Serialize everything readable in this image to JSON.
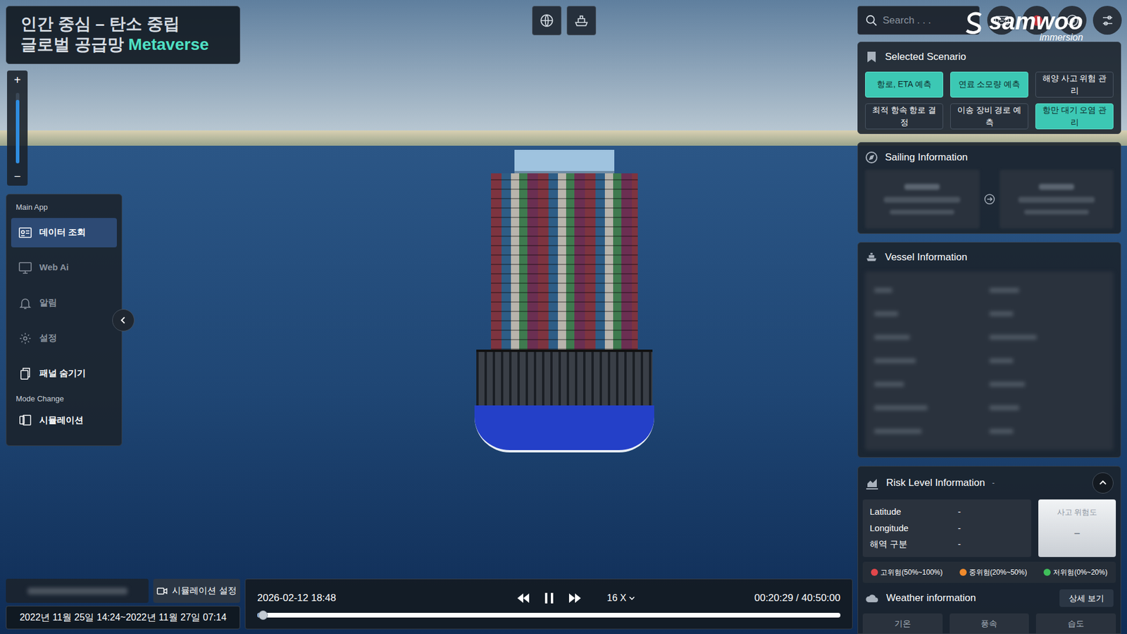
{
  "title": {
    "line1": "인간 중심 – 탄소 중립",
    "line2": "글로벌 공급망",
    "highlight": "Metaverse"
  },
  "zoom": {
    "plus": "+",
    "minus": "−",
    "level": 0.9
  },
  "menu": {
    "sections": [
      {
        "heading": "Main App",
        "items": [
          {
            "label": "데이터 조회",
            "selected": true,
            "disabled": false
          },
          {
            "label": "Web Ai",
            "selected": false,
            "disabled": true
          },
          {
            "label": "알림",
            "selected": false,
            "disabled": true
          },
          {
            "label": "설정",
            "selected": false,
            "disabled": true
          },
          {
            "label": "패널 숨기기",
            "selected": false,
            "disabled": false
          }
        ]
      },
      {
        "heading": "Mode Change",
        "items": [
          {
            "label": "시뮬레이션",
            "selected": false,
            "disabled": false
          }
        ]
      }
    ]
  },
  "search": {
    "placeholder": "Search . . ."
  },
  "logo": {
    "name": "samwoo",
    "tagline": "immersion"
  },
  "scenario": {
    "title": "Selected Scenario",
    "options": [
      {
        "label": "항로, ETA 예측",
        "selected": true
      },
      {
        "label": "연료 소모량 예측",
        "selected": true
      },
      {
        "label": "해양 사고 위험 관리",
        "selected": false
      },
      {
        "label": "최적 항속 항로 결정",
        "selected": false
      },
      {
        "label": "이송 장비 경로 예측",
        "selected": false
      },
      {
        "label": "항만 대기 오염 관리",
        "selected": true
      }
    ]
  },
  "sailing": {
    "title": "Sailing Information"
  },
  "vessel": {
    "title": "Vessel Information"
  },
  "risk": {
    "title": "Risk Level Information",
    "status": "-",
    "rows": [
      {
        "label": "Latitude",
        "value": "-"
      },
      {
        "label": "Longitude",
        "value": "-"
      },
      {
        "label": "해역 구분",
        "value": "-"
      }
    ],
    "gauge": {
      "label": "사고 위험도",
      "value": "–"
    },
    "legend": [
      {
        "label": "고위험(50%~100%)",
        "color": "#e2474b"
      },
      {
        "label": "중위험(20%~50%)",
        "color": "#f08a2c"
      },
      {
        "label": "저위험(0%~20%)",
        "color": "#3fbf5a"
      }
    ]
  },
  "weather": {
    "title": "Weather information",
    "detail_button": "상세 보기",
    "tabs": [
      "기온",
      "풍속",
      "습도"
    ]
  },
  "simulation": {
    "settings_button": "시뮬레이션 설정",
    "date_range": "2022년 11월 25일 14:24~2022년 11월 27일 07:14"
  },
  "playback": {
    "current": "2026-02-12 18:48",
    "playing": true,
    "speed": "16 X",
    "time": "00:20:29 / 40:50:00",
    "level": 0.01
  }
}
